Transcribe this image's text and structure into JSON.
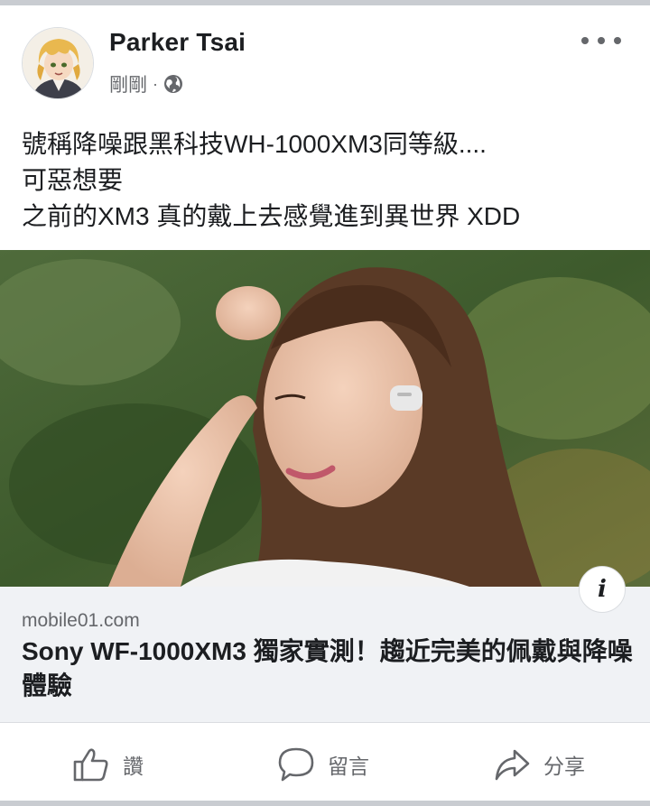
{
  "post": {
    "author": "Parker Tsai",
    "timestamp": "剛剛",
    "separator": "·",
    "audience_icon": "globe-icon",
    "text_lines": [
      "號稱降噪跟黑科技WH-1000XM3同等級....",
      "可惡想要",
      "之前的XM3 真的戴上去感覺進到異世界 XDD"
    ]
  },
  "link": {
    "domain": "mobile01.com",
    "title": "Sony WF-1000XM3 獨家實測！趨近完美的佩戴與降噪體驗",
    "info_icon_label": "i"
  },
  "actions": {
    "like": {
      "label": "讚",
      "icon": "thumbs-up-icon"
    },
    "comment": {
      "label": "留言",
      "icon": "speech-bubble-icon"
    },
    "share": {
      "label": "分享",
      "icon": "share-arrow-icon"
    }
  },
  "colors": {
    "text_primary": "#1c1e21",
    "text_secondary": "#65676b",
    "caption_bg": "#f0f2f5",
    "border": "#c9ccd1"
  }
}
